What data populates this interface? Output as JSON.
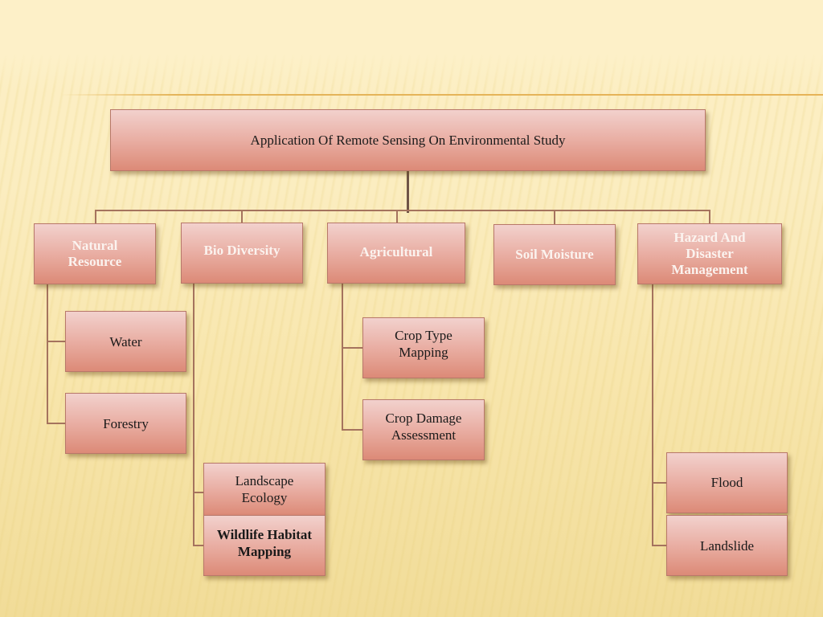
{
  "diagram": {
    "root": {
      "label": "Application Of Remote Sensing On Environmental Study"
    },
    "categories": [
      {
        "label": "Natural\nResource",
        "children": [
          {
            "label": "Water"
          },
          {
            "label": "Forestry"
          }
        ]
      },
      {
        "label": "Bio Diversity",
        "children": [
          {
            "label": "Landscape\nEcology"
          },
          {
            "label": "Wildlife Habitat\nMapping"
          }
        ]
      },
      {
        "label": "Agricultural",
        "children": [
          {
            "label": "Crop Type\nMapping"
          },
          {
            "label": "Crop Damage\nAssessment"
          }
        ]
      },
      {
        "label": "Soil Moisture",
        "children": []
      },
      {
        "label": "Hazard And\nDisaster\nManagement",
        "children": [
          {
            "label": "Flood"
          },
          {
            "label": "Landslide"
          }
        ]
      }
    ]
  }
}
